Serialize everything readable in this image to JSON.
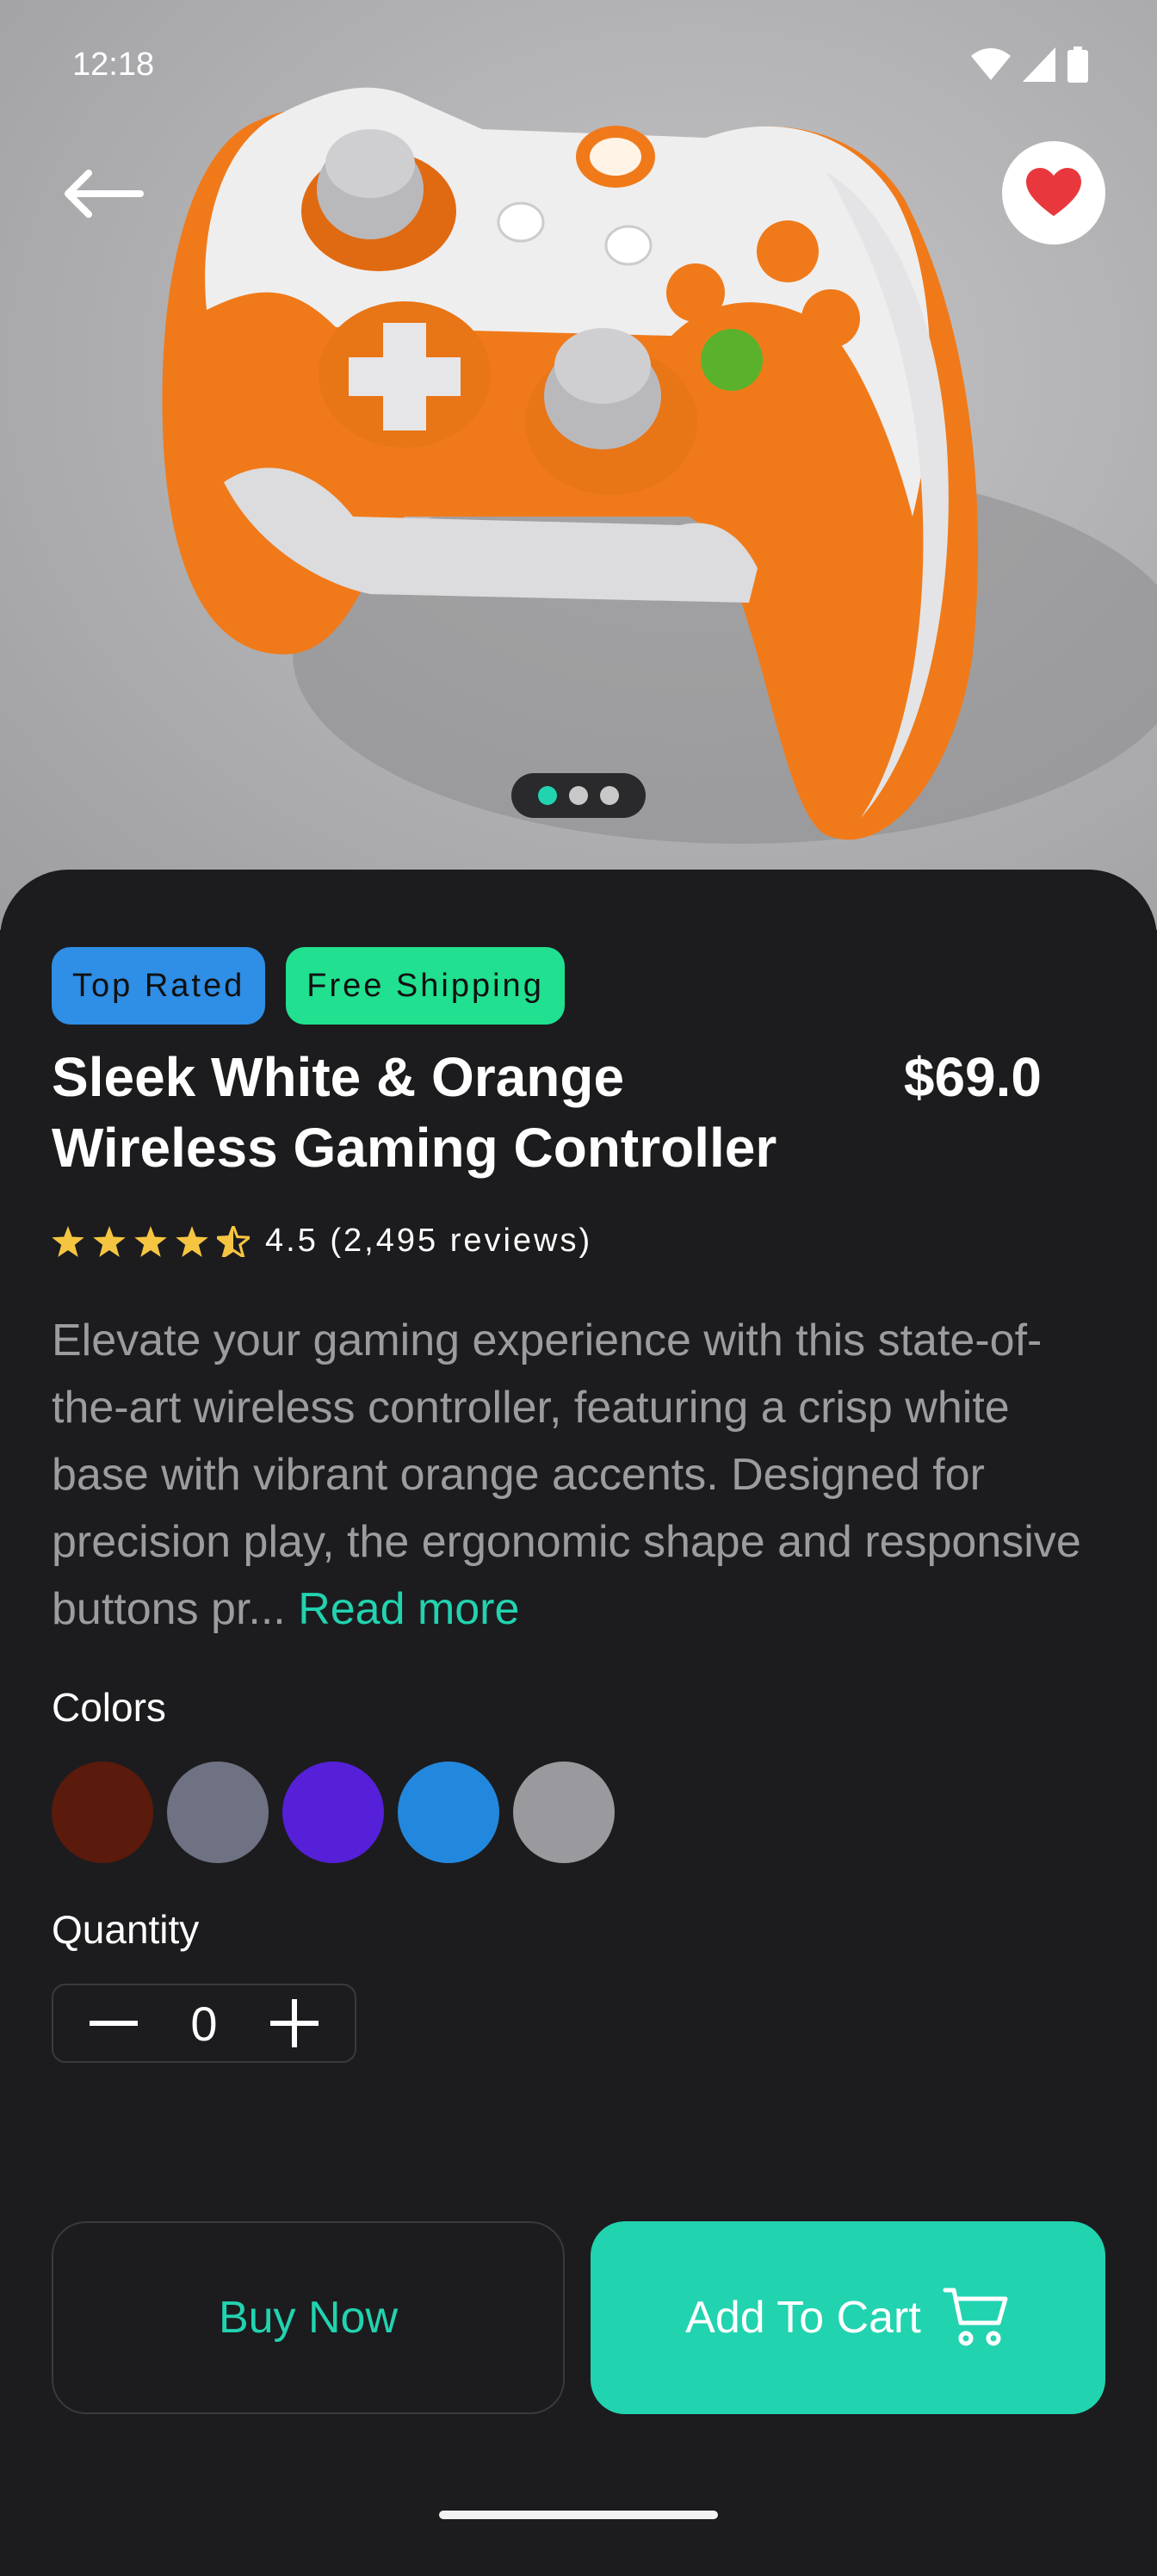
{
  "status_bar": {
    "time": "12:18"
  },
  "product": {
    "image_alt": "White and orange wireless gaming controller",
    "tags": [
      "Top Rated",
      "Free Shipping"
    ],
    "title_line1": "Sleek White & Orange",
    "title_line2": "Wireless Gaming Controller",
    "price": "$69.0",
    "rating_value": 4.5,
    "rating_text": "4.5 (2,495 reviews)",
    "description": "Elevate your gaming experience with this state-of-the-art wireless controller, featuring a crisp white base with vibrant orange accents. Designed for precision play, the ergonomic shape and responsive buttons pr... ",
    "read_more": "Read more"
  },
  "colors_section": {
    "label": "Colors",
    "swatches": [
      "#5a1a0c",
      "#6e7282",
      "#5520d8",
      "#2288dd",
      "#9a9a9e"
    ]
  },
  "quantity_section": {
    "label": "Quantity",
    "value": "0"
  },
  "actions": {
    "buy_now": "Buy Now",
    "add_to_cart": "Add To Cart"
  },
  "theme": {
    "accent": "#22d3b0",
    "tag_blue": "#2f8ee5",
    "tag_green": "#21e08f",
    "star": "#f5c542",
    "favorite": "#e8383e"
  },
  "pager": {
    "count": 3,
    "active": 0
  }
}
